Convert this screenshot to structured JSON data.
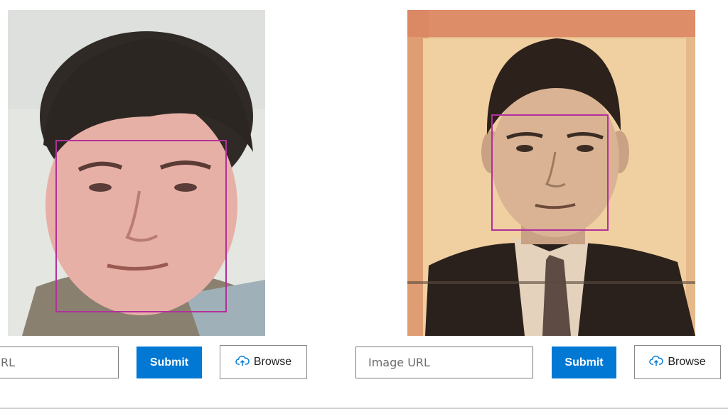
{
  "left_panel": {
    "url_input": {
      "value": "RL",
      "placeholder": "Image URL"
    },
    "submit_label": "Submit",
    "browse_label": "Browse"
  },
  "right_panel": {
    "url_input": {
      "value": "",
      "placeholder": "Image URL"
    },
    "submit_label": "Submit",
    "browse_label": "Browse"
  },
  "icons": {
    "browse": "upload-cloud-icon"
  },
  "colors": {
    "accent": "#0078d4",
    "face_box": "#b3309c"
  }
}
